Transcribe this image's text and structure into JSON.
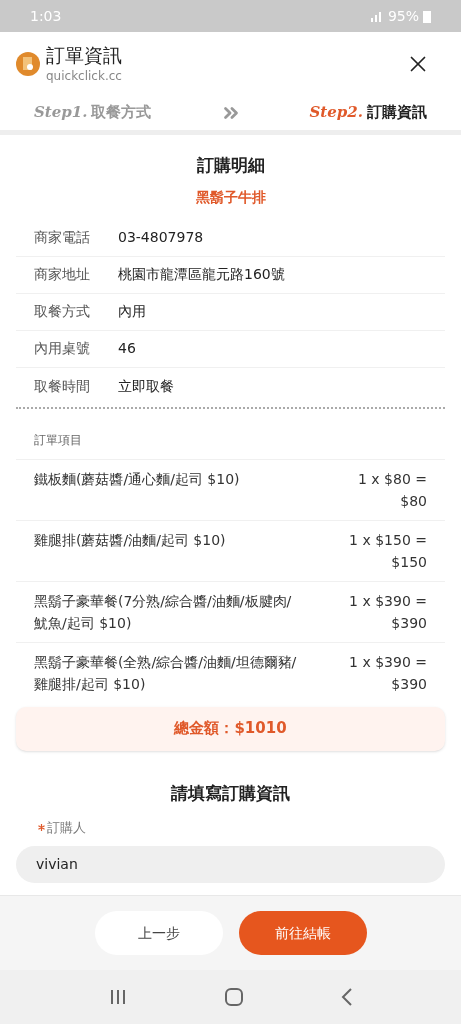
{
  "status_bar": {
    "time": "1:03",
    "battery": "95%"
  },
  "header": {
    "title": "訂單資訊",
    "url": "quickclick.cc"
  },
  "steps": [
    {
      "label": "Step1.",
      "name": "取餐方式",
      "selected": false
    },
    {
      "label": "Step2.",
      "name": "訂購資訊",
      "selected": true
    }
  ],
  "details": {
    "title": "訂購明細",
    "store": "黑鬍子牛排",
    "rows": [
      {
        "label": "商家電話",
        "value": "03-4807978"
      },
      {
        "label": "商家地址",
        "value": "桃園市龍潭區龍元路160號"
      },
      {
        "label": "取餐方式",
        "value": "內用"
      },
      {
        "label": "內用桌號",
        "value": "46"
      },
      {
        "label": "取餐時間",
        "value": "立即取餐"
      }
    ]
  },
  "order": {
    "heading": "訂單項目",
    "items": [
      {
        "name": "鐵板麵(蘑菇醬/通心麵/起司 $10)",
        "price": "1 x $80 = $80"
      },
      {
        "name": "雞腿排(蘑菇醬/油麵/起司 $10)",
        "price": "1 x $150 = $150"
      },
      {
        "name": "黑鬍子豪華餐(7分熟/綜合醬/油麵/板腱肉/魷魚/起司 $10)",
        "price": "1 x $390 = $390"
      },
      {
        "name": "黑鬍子豪華餐(全熟/綜合醬/油麵/坦德爾豬/雞腿排/起司 $10)",
        "price": "1 x $390 = $390"
      }
    ],
    "total": "總金額：$1010"
  },
  "form": {
    "title": "請填寫訂購資訊",
    "fields": [
      {
        "label": "訂購人",
        "required": true,
        "value": "vivian"
      }
    ]
  },
  "buttons": {
    "back": "上一步",
    "next": "前往結帳"
  }
}
